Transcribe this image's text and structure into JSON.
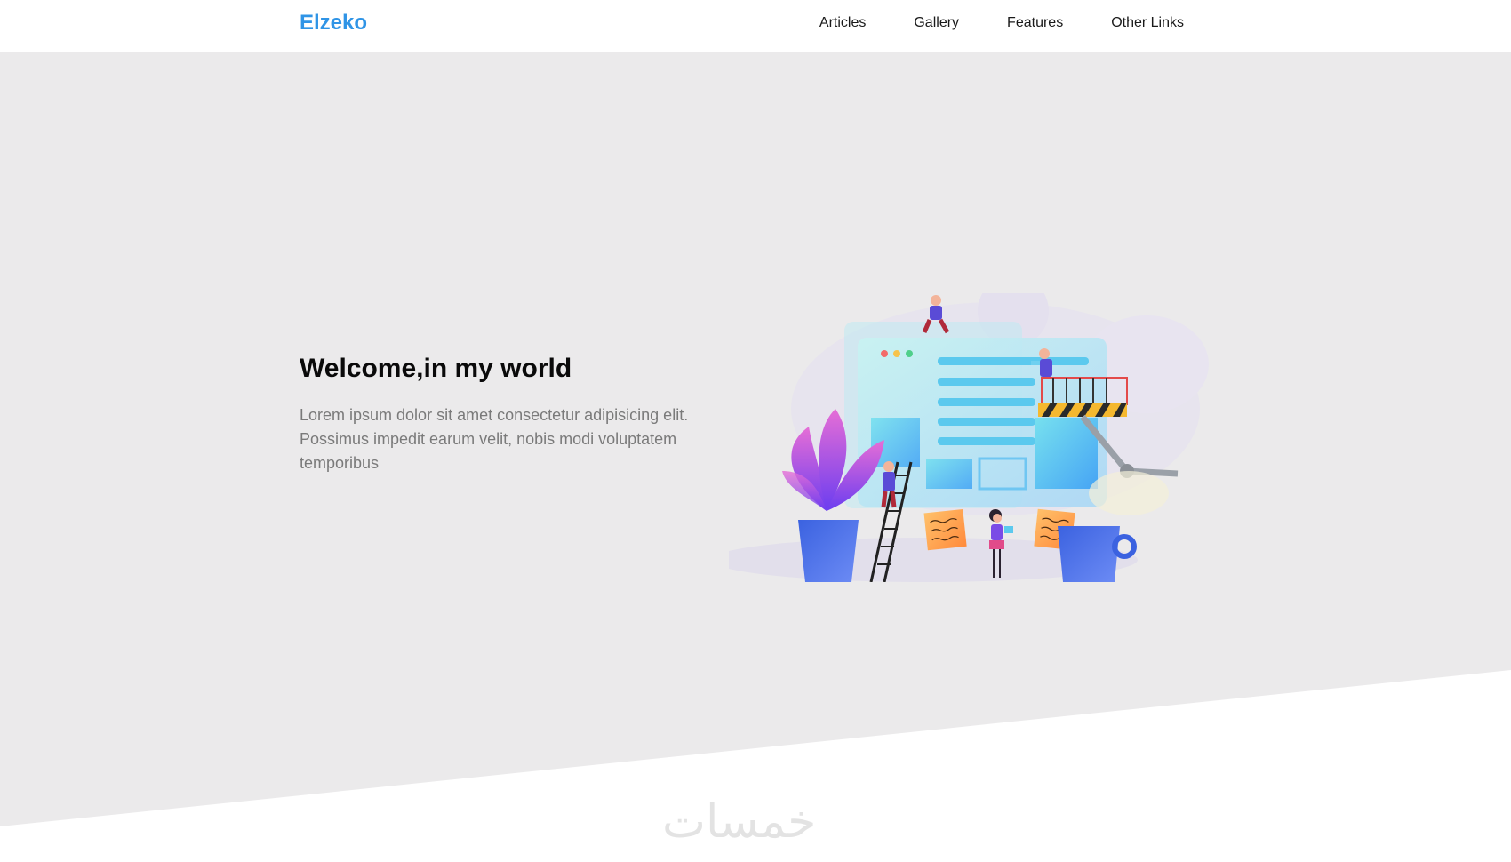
{
  "header": {
    "logo": "Elzeko",
    "nav": [
      "Articles",
      "Gallery",
      "Features",
      "Other Links"
    ]
  },
  "hero": {
    "title": "Welcome,in my world",
    "text": "Lorem ipsum dolor sit amet consectetur adipisicing elit. Possimus impedit earum velit, nobis modi voluptatem temporibus"
  },
  "watermark": "خمسات",
  "colors": {
    "brand": "#2f94e6",
    "hero_bg": "#ebeaeb",
    "body_text": "#7a7a7a"
  },
  "icons": {
    "illustration": "website-building-team-illustration"
  }
}
